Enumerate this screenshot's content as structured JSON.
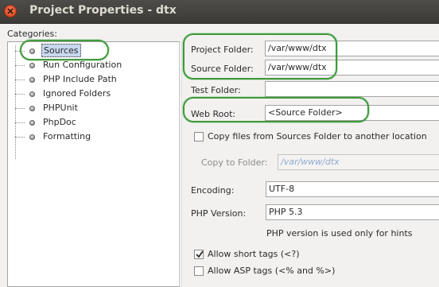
{
  "window": {
    "title": "Project Properties - dtx"
  },
  "categories": {
    "label": "Categories:",
    "items": [
      {
        "label": "Sources"
      },
      {
        "label": "Run Configuration"
      },
      {
        "label": "PHP Include Path"
      },
      {
        "label": "Ignored Folders"
      },
      {
        "label": "PHPUnit"
      },
      {
        "label": "PhpDoc"
      },
      {
        "label": "Formatting"
      }
    ]
  },
  "form": {
    "project_folder": {
      "label": "Project Folder:",
      "value": "/var/www/dtx"
    },
    "source_folder": {
      "label": "Source Folder:",
      "value": "/var/www/dtx"
    },
    "test_folder": {
      "label": "Test Folder:",
      "value": ""
    },
    "web_root": {
      "label": "Web Root:",
      "value": "<Source Folder>"
    },
    "copy_files": {
      "label": "Copy files from Sources Folder to another location",
      "checked": false
    },
    "copy_to_folder": {
      "label": "Copy to Folder:",
      "value": "/var/www/dtx"
    },
    "encoding": {
      "label": "Encoding:",
      "value": "UTF-8"
    },
    "php_version": {
      "label": "PHP Version:",
      "value": "PHP 5.3",
      "hint": "PHP version is used only for hints"
    },
    "short_tags": {
      "label": "Allow short tags (<?)",
      "checked": true
    },
    "asp_tags": {
      "label": "Allow ASP tags (<% and %>)",
      "checked": false
    }
  },
  "colors": {
    "highlight_outline": "#3e9a3a",
    "titlebar": "#3c3b37",
    "selection": "#c7d8ef"
  }
}
